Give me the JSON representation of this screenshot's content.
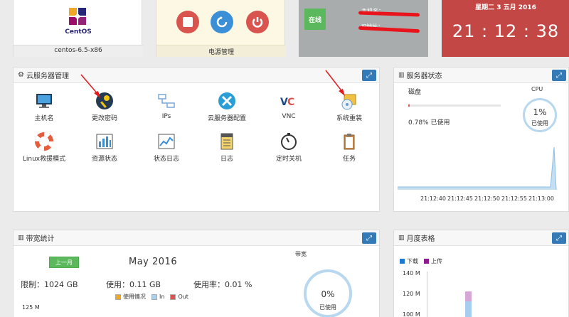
{
  "os_card": {
    "name": "centos-6.5-x86",
    "logo_text": "CentOS"
  },
  "power_card": {
    "label": "电源管理"
  },
  "status_card": {
    "online": "在线",
    "hostname_label": "主机名：",
    "ip_label": "IP地址："
  },
  "clock_card": {
    "date": "星期二 3 五月 2016",
    "time": "21 : 12 : 38"
  },
  "server_mgmt": {
    "title": "云服务器管理",
    "tools": [
      {
        "label": "主机名"
      },
      {
        "label": "更改密码"
      },
      {
        "label": "IPs"
      },
      {
        "label": "云服务器配置"
      },
      {
        "label": "VNC"
      },
      {
        "label": "系统重装"
      },
      {
        "label": "Linux救援模式"
      },
      {
        "label": "资源状态"
      },
      {
        "label": "状态日志"
      },
      {
        "label": "日志"
      },
      {
        "label": "定时关机"
      },
      {
        "label": "任务"
      }
    ]
  },
  "server_status": {
    "title": "服务器状态",
    "disk_label": "磁盘",
    "disk_used": "0.78% 已使用",
    "cpu_label": "CPU",
    "cpu_value": "1%",
    "cpu_used": "已使用",
    "times": [
      "21:12:40",
      "21:12:45",
      "21:12:50",
      "21:12:55",
      "21:13:00"
    ]
  },
  "bandwidth": {
    "title": "带宽统计",
    "prev_button": "上一月",
    "month": "May 2016",
    "band_label": "带宽",
    "limit": "限制：1024 GB",
    "used": "使用：0.11 GB",
    "usage_rate": "使用率：0.01 %",
    "legend": [
      "使用情况",
      "In",
      "Out"
    ],
    "y_top": "125 M",
    "ring_value": "0%",
    "ring_used": "已使用"
  },
  "monthly": {
    "title": "月度表格",
    "legend": [
      "下载",
      "上传"
    ],
    "y_ticks": [
      "140 M",
      "120 M",
      "100 M"
    ]
  },
  "colors": {
    "accent": "#337ab7",
    "green": "#5cb85c",
    "red": "#c9302c",
    "clock_bg": "#c34845",
    "status_bg": "#a8acad"
  }
}
